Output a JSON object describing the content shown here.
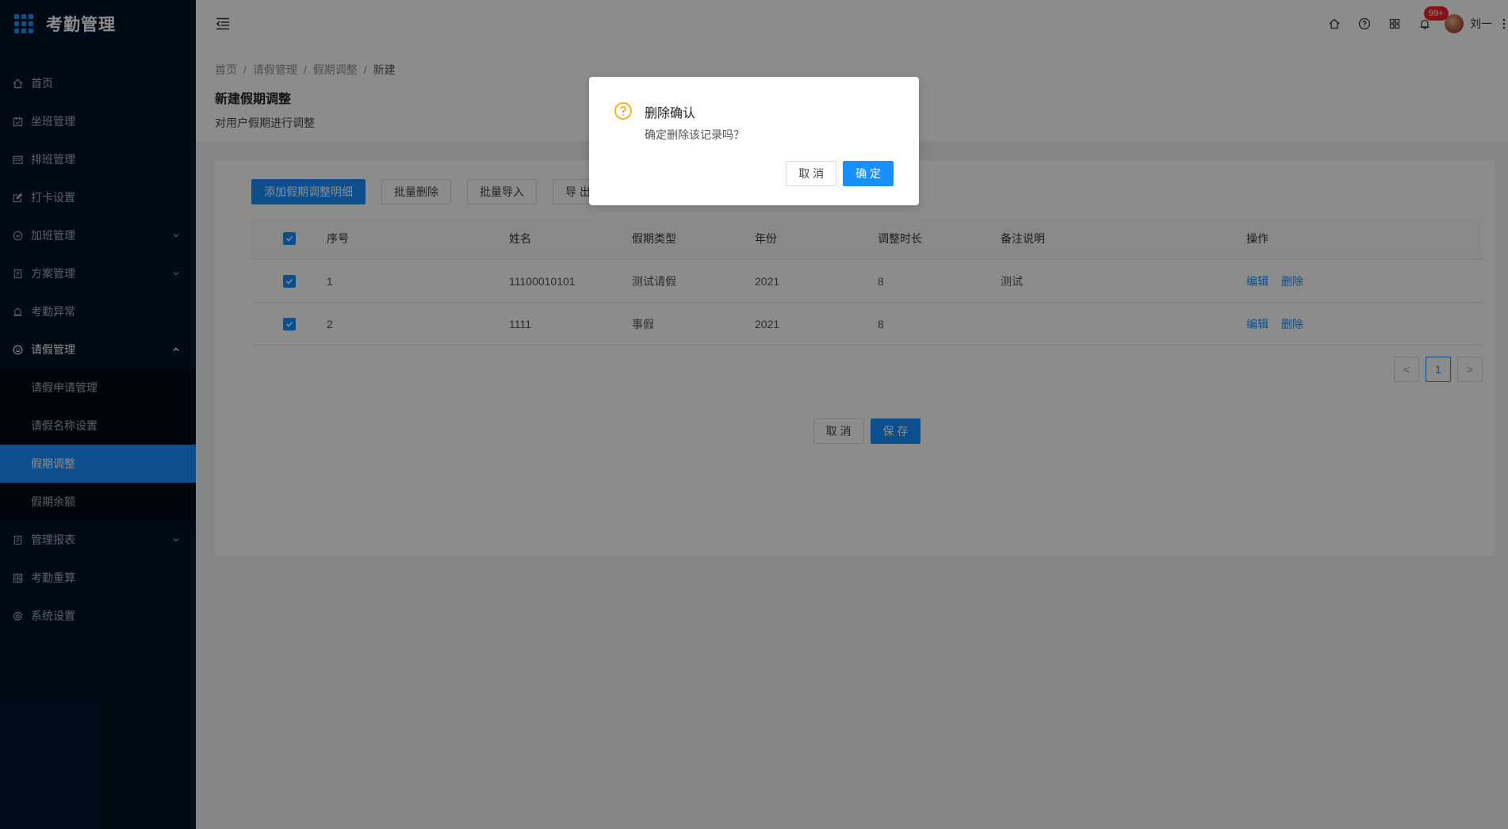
{
  "app": {
    "title": "考勤管理"
  },
  "sidebar": {
    "items": [
      {
        "label": "首页",
        "icon": "home-icon",
        "has_arrow": false
      },
      {
        "label": "坐班管理",
        "icon": "calendar-check-icon",
        "has_arrow": false
      },
      {
        "label": "排班管理",
        "icon": "schedule-icon",
        "has_arrow": false
      },
      {
        "label": "打卡设置",
        "icon": "edit-icon",
        "has_arrow": false
      },
      {
        "label": "加班管理",
        "icon": "clock-icon",
        "has_arrow": true
      },
      {
        "label": "方案管理",
        "icon": "file-icon",
        "has_arrow": true
      },
      {
        "label": "考勤异常",
        "icon": "alarm-icon",
        "has_arrow": false
      },
      {
        "label": "请假管理",
        "icon": "smile-icon",
        "has_arrow": true,
        "open": true
      }
    ],
    "submenu": [
      {
        "label": "请假申请管理"
      },
      {
        "label": "请假名称设置"
      },
      {
        "label": "假期调整",
        "active": true
      },
      {
        "label": "假期余额"
      }
    ],
    "items_after": [
      {
        "label": "管理报表",
        "icon": "report-icon",
        "has_arrow": true
      },
      {
        "label": "考勤重算",
        "icon": "calculator-icon",
        "has_arrow": false
      },
      {
        "label": "系统设置",
        "icon": "gear-icon",
        "has_arrow": false
      }
    ]
  },
  "header": {
    "notification_badge": "99+",
    "username": "刘一"
  },
  "breadcrumb": {
    "items": [
      "首页",
      "请假管理",
      "假期调整",
      "新建"
    ]
  },
  "page": {
    "title": "新建假期调整",
    "description": "对用户假期进行调整"
  },
  "toolbar": {
    "add_label": "添加假期调整明细",
    "batch_delete_label": "批量删除",
    "batch_import_label": "批量导入",
    "export_label": "导 出"
  },
  "table": {
    "columns": [
      "序号",
      "姓名",
      "假期类型",
      "年份",
      "调整时长",
      "备注说明",
      "操作"
    ],
    "rows": [
      {
        "seq": "1",
        "name": "11100010101",
        "type": "测试请假",
        "year": "2021",
        "duration": "8",
        "note": "测试",
        "edit": "编辑",
        "delete": "删除"
      },
      {
        "seq": "2",
        "name": "1111",
        "type": "事假",
        "year": "2021",
        "duration": "8",
        "note": "",
        "edit": "编辑",
        "delete": "删除"
      }
    ]
  },
  "pagination": {
    "current": "1",
    "prev": "<",
    "next": ">"
  },
  "footer": {
    "cancel_label": "取 消",
    "save_label": "保 存"
  },
  "modal": {
    "title": "删除确认",
    "content": "确定删除该记录吗？",
    "cancel_label": "取 消",
    "ok_label": "确 定"
  },
  "colors": {
    "primary": "#1890ff",
    "sidebar_bg": "#001529",
    "warning": "#faad14",
    "badge": "#f5222d"
  }
}
